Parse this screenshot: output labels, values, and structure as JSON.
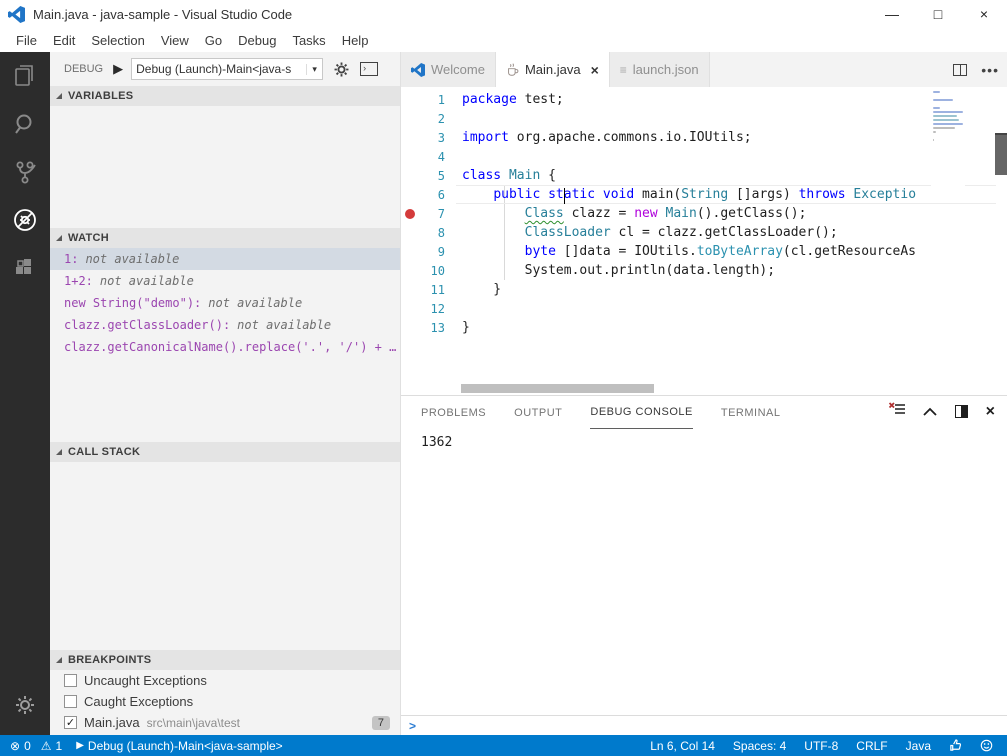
{
  "window": {
    "title": "Main.java - java-sample - Visual Studio Code"
  },
  "menu": {
    "items": [
      "File",
      "Edit",
      "Selection",
      "View",
      "Go",
      "Debug",
      "Tasks",
      "Help"
    ]
  },
  "activity_bar": {
    "icons": [
      "explorer",
      "search",
      "source-control",
      "debug",
      "extensions",
      "settings-gear"
    ]
  },
  "debug_toolbar": {
    "label": "DEBUG",
    "config_value": "Debug (Launch)-Main<java-s"
  },
  "sidebar": {
    "sections": {
      "variables": "VARIABLES",
      "watch": "WATCH",
      "call_stack": "CALL STACK",
      "breakpoints": "BREAKPOINTS"
    },
    "watch_items": [
      {
        "expr": "1:",
        "value": "not available",
        "selected": true
      },
      {
        "expr": "1+2:",
        "value": "not available",
        "selected": false
      },
      {
        "expr": "new String(\"demo\"):",
        "value": "not available",
        "selected": false
      },
      {
        "expr": "clazz.getClassLoader():",
        "value": "not available",
        "selected": false
      },
      {
        "expr": "clazz.getCanonicalName().replace('.', '/') + …",
        "value": "",
        "selected": false
      }
    ],
    "breakpoint_items": [
      {
        "label": "Uncaught Exceptions",
        "checked": false,
        "path": "",
        "badge": ""
      },
      {
        "label": "Caught Exceptions",
        "checked": false,
        "path": "",
        "badge": ""
      },
      {
        "label": "Main.java",
        "checked": true,
        "path": "src\\main\\java\\test",
        "badge": "7"
      }
    ]
  },
  "tabs": [
    {
      "label": "Welcome",
      "icon": "vscode-logo",
      "active": false
    },
    {
      "label": "Main.java",
      "icon": "java-cup",
      "active": true
    },
    {
      "label": "launch.json",
      "icon": "json-lines",
      "active": false
    }
  ],
  "editor": {
    "breakpoint_line": 7,
    "caret": {
      "line": 6,
      "col": 14
    },
    "lines": [
      {
        "num": 1,
        "segs": [
          [
            "package",
            "k"
          ],
          [
            " test;",
            "p"
          ]
        ]
      },
      {
        "num": 2,
        "segs": []
      },
      {
        "num": 3,
        "segs": [
          [
            "import",
            "k"
          ],
          [
            " org.apache.commons.io.IOUtils;",
            "p"
          ]
        ]
      },
      {
        "num": 4,
        "segs": []
      },
      {
        "num": 5,
        "segs": [
          [
            "class",
            "k"
          ],
          [
            " ",
            "p"
          ],
          [
            "Main",
            "t"
          ],
          [
            " {",
            "p"
          ]
        ]
      },
      {
        "num": 6,
        "segs": [
          [
            "    ",
            "p"
          ],
          [
            "public",
            "k"
          ],
          [
            " ",
            "p"
          ],
          [
            "static",
            "k"
          ],
          [
            " ",
            "p"
          ],
          [
            "void",
            "k"
          ],
          [
            " main(",
            "p"
          ],
          [
            "String",
            "t"
          ],
          [
            " []args) ",
            "p"
          ],
          [
            "throws",
            "k"
          ],
          [
            " ",
            "p"
          ],
          [
            "Exceptio",
            "t"
          ]
        ]
      },
      {
        "num": 7,
        "segs": [
          [
            "        ",
            "p"
          ],
          [
            "Class",
            "t",
            "sq"
          ],
          [
            " clazz = ",
            "p"
          ],
          [
            "new",
            "n"
          ],
          [
            " ",
            "p"
          ],
          [
            "Main",
            "t"
          ],
          [
            "().getClass();",
            "p"
          ]
        ]
      },
      {
        "num": 8,
        "segs": [
          [
            "        ",
            "p"
          ],
          [
            "ClassLoader",
            "t"
          ],
          [
            " cl = clazz.getClassLoader();",
            "p"
          ]
        ]
      },
      {
        "num": 9,
        "segs": [
          [
            "        ",
            "p"
          ],
          [
            "byte",
            "k"
          ],
          [
            " []data = IOUtils.",
            "p"
          ],
          [
            "toByteArray",
            "m"
          ],
          [
            "(cl.getResourceAs",
            "p"
          ]
        ]
      },
      {
        "num": 10,
        "segs": [
          [
            "        System.out.println(data.length);",
            "p"
          ]
        ]
      },
      {
        "num": 11,
        "segs": [
          [
            "    }",
            "p"
          ]
        ]
      },
      {
        "num": 12,
        "segs": []
      },
      {
        "num": 13,
        "segs": [
          [
            "}",
            "p"
          ]
        ]
      }
    ]
  },
  "panel": {
    "tabs": [
      "PROBLEMS",
      "OUTPUT",
      "DEBUG CONSOLE",
      "TERMINAL"
    ],
    "active_tab": "DEBUG CONSOLE",
    "output": "1362"
  },
  "status_bar": {
    "errors": "0",
    "warnings": "1",
    "debug_label": "Debug (Launch)-Main<java-sample>",
    "right_items": [
      "Ln 6, Col 14",
      "Spaces: 4",
      "UTF-8",
      "CRLF",
      "Java"
    ]
  },
  "colors": {
    "accent": "#007acc",
    "activity_bar": "#2c2c2c",
    "breakpoint": "#d43b3b",
    "selection": "#d3dae3",
    "keyword": "#0000ff",
    "type": "#267f99",
    "new_keyword": "#af00db",
    "line_number": "#2b91af"
  }
}
